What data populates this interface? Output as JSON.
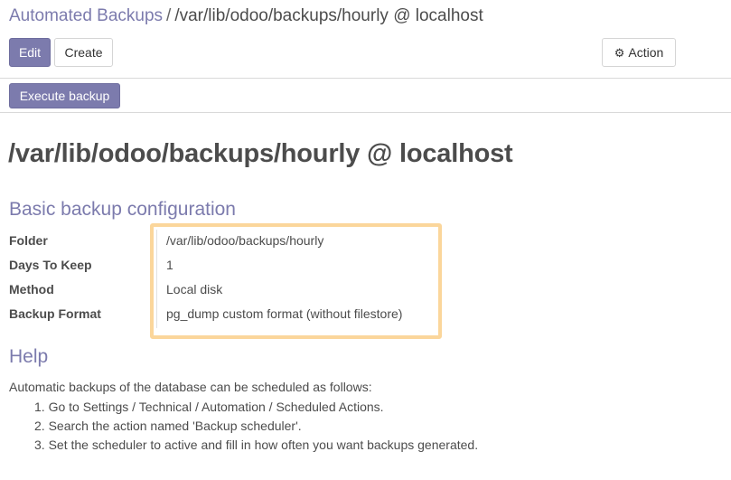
{
  "breadcrumb": {
    "parent": "Automated Backups",
    "separator": "/",
    "current": "/var/lib/odoo/backups/hourly @ localhost"
  },
  "toolbar": {
    "edit_label": "Edit",
    "create_label": "Create",
    "action_label": "Action",
    "action_icon": "gear-icon"
  },
  "header_buttons": {
    "execute_backup_label": "Execute backup"
  },
  "record": {
    "title": "/var/lib/odoo/backups/hourly @ localhost"
  },
  "basic_config": {
    "section_title": "Basic backup configuration",
    "fields": [
      {
        "label": "Folder",
        "value": "/var/lib/odoo/backups/hourly"
      },
      {
        "label": "Days To Keep",
        "value": "1"
      },
      {
        "label": "Method",
        "value": "Local disk"
      },
      {
        "label": "Backup Format",
        "value": "pg_dump custom format (without filestore)"
      }
    ]
  },
  "help": {
    "section_title": "Help",
    "intro": "Automatic backups of the database can be scheduled as follows:",
    "steps": [
      "1. Go to Settings / Technical / Automation / Scheduled Actions.",
      "2. Search the action named 'Backup scheduler'.",
      "3. Set the scheduler to active and fill in how often you want backups generated."
    ]
  },
  "colors": {
    "accent": "#7c7bad",
    "highlight": "#fbd69b",
    "text": "#4c4c4c"
  }
}
